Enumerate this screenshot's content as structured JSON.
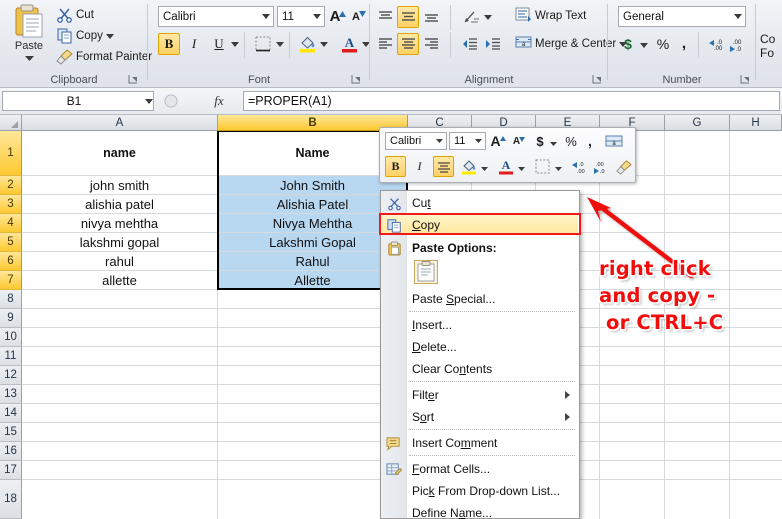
{
  "app": "Microsoft Excel 2010",
  "ribbon": {
    "groups": [
      {
        "name": "clipboard",
        "label": "Clipboard"
      },
      {
        "name": "font",
        "label": "Font"
      },
      {
        "name": "alignment",
        "label": "Alignment"
      },
      {
        "name": "number",
        "label": "Number"
      },
      {
        "name": "styles",
        "label": "Co Fo"
      }
    ],
    "clipboard": {
      "paste_label": "Paste",
      "cut_label": "Cut",
      "copy_label": "Copy",
      "format_painter_label": "Format Painter"
    },
    "font": {
      "family": "Calibri",
      "size": "11",
      "bold_label": "B",
      "italic_label": "I",
      "underline_label": "U",
      "grow_font_label": "A",
      "shrink_font_label": "A"
    },
    "alignment": {
      "wrap_text_label": "Wrap Text",
      "merge_center_label": "Merge & Center"
    },
    "number": {
      "format": "General",
      "currency_label": "$",
      "percent_label": "%",
      "comma_label": ",",
      "increase_decimal_label": ".00",
      "decrease_decimal_label": ".00"
    },
    "styles": {
      "line1": "Co",
      "line2": "Fo"
    }
  },
  "formula_bar": {
    "name_box": "B1",
    "fx_label": "fx",
    "formula": "=PROPER(A1)"
  },
  "sheet": {
    "columns": [
      "A",
      "B",
      "C",
      "D",
      "E",
      "F",
      "G",
      "H"
    ],
    "selected_column": "B",
    "rows": [
      "1",
      "2",
      "3",
      "4",
      "5",
      "6",
      "7",
      "8",
      "9",
      "10",
      "11",
      "12",
      "13",
      "14",
      "15",
      "16",
      "17",
      "18"
    ],
    "selected_rows": [
      "1",
      "2",
      "3",
      "4",
      "5",
      "6",
      "7"
    ],
    "column_a": [
      "name",
      "john smith",
      "alishia patel",
      "nivya mehtha",
      "lakshmi gopal",
      "rahul",
      "allette"
    ],
    "column_b": [
      "Name",
      "John Smith",
      "Alishia Patel",
      "Nivya Mehtha",
      "Lakshmi Gopal",
      "Rahul",
      "Allette"
    ],
    "selection_fill": "#b8d7f0",
    "header_selected_color": "#fdc830"
  },
  "mini_toolbar": {
    "font_family": "Calibri",
    "font_size": "11",
    "grow_font_label": "A",
    "shrink_font_label": "A",
    "currency_label": "$",
    "percent_label": "%",
    "comma_label": ",",
    "bold_label": "B",
    "italic_label": "I",
    "increase_decimal_label": ".00",
    "decrease_decimal_label": ".00"
  },
  "context_menu": {
    "highlighted_item": "Copy",
    "highlight_color": "#ef1b1b",
    "items": [
      {
        "label": "Cut",
        "icon": "scissors-icon",
        "submenu": false
      },
      {
        "label": "Copy",
        "icon": "copy-icon",
        "submenu": false
      },
      {
        "label": "Paste Options:",
        "icon": "paste-icon",
        "submenu": false
      },
      {
        "label": "Paste Special...",
        "icon": "none",
        "submenu": false
      },
      {
        "label": "Insert...",
        "icon": "none",
        "submenu": false
      },
      {
        "label": "Delete...",
        "icon": "none",
        "submenu": false
      },
      {
        "label": "Clear Contents",
        "icon": "none",
        "submenu": false
      },
      {
        "label": "Filter",
        "icon": "none",
        "submenu": true
      },
      {
        "label": "Sort",
        "icon": "none",
        "submenu": true
      },
      {
        "label": "Insert Comment",
        "icon": "comment-icon",
        "submenu": false
      },
      {
        "label": "Format Cells...",
        "icon": "format-cells-icon",
        "submenu": false
      },
      {
        "label": "Pick From Drop-down List...",
        "icon": "none",
        "submenu": false
      },
      {
        "label": "Define Name...",
        "icon": "none",
        "submenu": false
      }
    ]
  },
  "annotation": {
    "line1": "right click",
    "line2": "and copy -",
    "line3": "or CTRL+C",
    "color": "#f20c0c"
  }
}
